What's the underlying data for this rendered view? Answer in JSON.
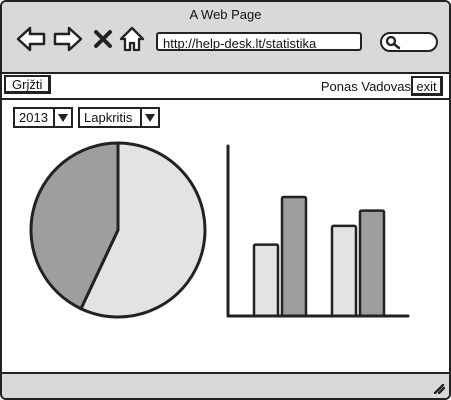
{
  "window": {
    "title": "A Web Page",
    "url": "http://help-desk.lt/statistika"
  },
  "toolbar": {
    "icons": [
      "back-arrow-icon",
      "forward-arrow-icon",
      "close-x-icon",
      "home-icon",
      "search-icon"
    ]
  },
  "appbar": {
    "back_label": "Grįžti",
    "user_name": "Ponas Vadovas",
    "exit_label": "exit"
  },
  "filters": {
    "year": "2013",
    "month": "Lapkritis"
  },
  "colors": {
    "light_fill": "#e3e3e3",
    "dark_fill": "#9e9e9e",
    "chrome": "#d9d9d9",
    "stroke": "#222222"
  },
  "chart_data": [
    {
      "type": "pie",
      "values": [
        57,
        43
      ],
      "colors": [
        "#e3e3e3",
        "#9e9e9e"
      ]
    },
    {
      "type": "bar",
      "categories": [
        "",
        ""
      ],
      "series": [
        {
          "values": [
            42,
            53
          ],
          "color": "#e3e3e3"
        },
        {
          "values": [
            70,
            62
          ],
          "color": "#9e9e9e"
        }
      ]
    }
  ]
}
